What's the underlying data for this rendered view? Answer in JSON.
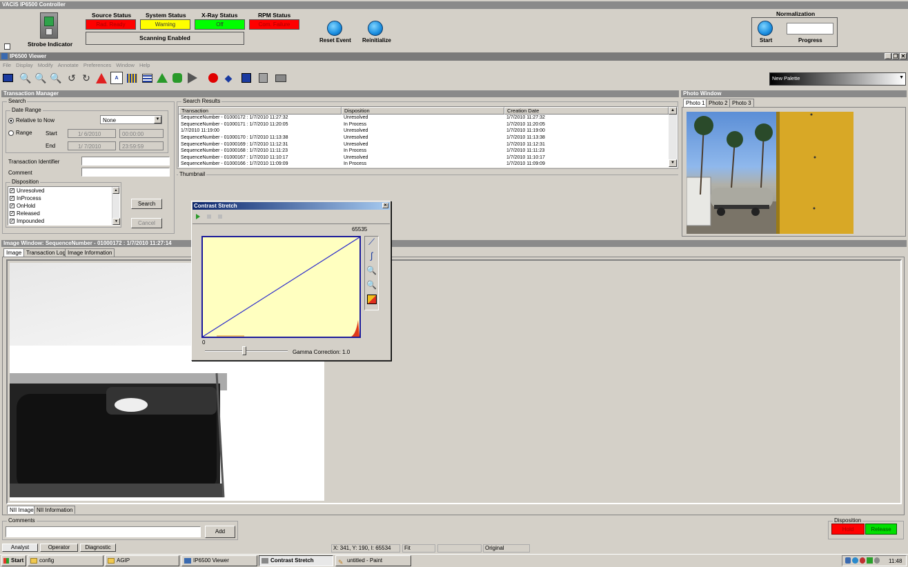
{
  "controller": {
    "title": "VACIS IP6500 Controller",
    "strobe_label": "Strobe Indicator",
    "status": [
      {
        "label": "Source Status",
        "value": "Rad. Ready",
        "color": "#ff0000"
      },
      {
        "label": "System Status",
        "value": "Warning",
        "color": "#ffff00"
      },
      {
        "label": "X-Ray Status",
        "value": "Off",
        "color": "#00ff00"
      },
      {
        "label": "RPM Status",
        "value": "Com. Failure",
        "color": "#ff0000"
      }
    ],
    "scanning": "Scanning Enabled",
    "reset_event": "Reset Event",
    "reinitialize": "Reinitialize",
    "normalization": {
      "title": "Normalization",
      "start": "Start",
      "progress": "Progress"
    }
  },
  "viewer": {
    "title": "IP6500 Viewer",
    "menu": [
      "File",
      "Display",
      "Modify",
      "Annotate",
      "Preferences",
      "Window",
      "Help"
    ],
    "palette": "New Palette"
  },
  "transaction_manager": {
    "title": "Transaction Manager",
    "search_legend": "Search",
    "date_range": "Date Range",
    "relative_to_now": "Relative to Now",
    "relative_value": "None",
    "range": "Range",
    "start": "Start",
    "end": "End",
    "start_date": "1/ 6/2010",
    "start_time": "00:00:00",
    "end_date": "1/ 7/2010",
    "end_time": "23:59:59",
    "transaction_identifier": "Transaction Identifier",
    "comment": "Comment",
    "disposition": "Disposition",
    "disposition_items": [
      "Unresolved",
      "InProcess",
      "OnHold",
      "Released",
      "Impounded"
    ],
    "search_button": "Search",
    "cancel_button": "Cancel"
  },
  "search_results": {
    "legend": "Search Results",
    "columns": [
      "Transaction",
      "Disposition",
      "Creation Date"
    ],
    "rows": [
      [
        "SequenceNumber - 01000172 : 1/7/2010 11:27:32",
        "Unresolved",
        "1/7/2010 11:27:32"
      ],
      [
        "SequenceNumber - 01000171 : 1/7/2010 11:20:05",
        "In Process",
        "1/7/2010 11:20:05"
      ],
      [
        "1/7/2010 11:19:00",
        "Unresolved",
        "1/7/2010 11:19:00"
      ],
      [
        "SequenceNumber - 01000170 : 1/7/2010 11:13:38",
        "Unresolved",
        "1/7/2010 11:13:38"
      ],
      [
        "SequenceNumber - 01000169 : 1/7/2010 11:12:31",
        "Unresolved",
        "1/7/2010 11:12:31"
      ],
      [
        "SequenceNumber - 01000168 : 1/7/2010 11:11:23",
        "In Process",
        "1/7/2010 11:11:23"
      ],
      [
        "SequenceNumber - 01000167 : 1/7/2010 11:10:17",
        "Unresolved",
        "1/7/2010 11:10:17"
      ],
      [
        "SequenceNumber - 01000166 : 1/7/2010 11:09:09",
        "In Process",
        "1/7/2010 11:09:09"
      ]
    ],
    "thumbnail": "Thumbnail"
  },
  "photo_window": {
    "title": "Photo Window",
    "tabs": [
      "Photo 1",
      "Photo 2",
      "Photo 3"
    ]
  },
  "contrast": {
    "title": "Contrast Stretch",
    "max": "65535",
    "min": "0",
    "gamma": "Gamma Correction:  1.0"
  },
  "image_window": {
    "title": "Image Window: SequenceNumber - 01000172 : 1/7/2010 11:27:14",
    "tabs": [
      "Image",
      "Transaction Log",
      "Image Information"
    ],
    "bottom_tabs": [
      "NII Image",
      "NII Information"
    ]
  },
  "comments": {
    "legend": "Comments",
    "add": "Add"
  },
  "disposition": {
    "legend": "Disposition",
    "hold": "Hold",
    "release": "Release"
  },
  "status_bar": {
    "tabs": [
      "Analyst",
      "Operator",
      "Diagnostic"
    ],
    "coords": "X: 341, Y: 190, I: 65534",
    "fit": "Fit",
    "original": "Original"
  },
  "taskbar": {
    "start": "Start",
    "items": [
      "config",
      "AGIP",
      "IP6500 Viewer",
      "Contrast Stretch",
      "untitled - Paint"
    ],
    "clock": "11:48"
  }
}
